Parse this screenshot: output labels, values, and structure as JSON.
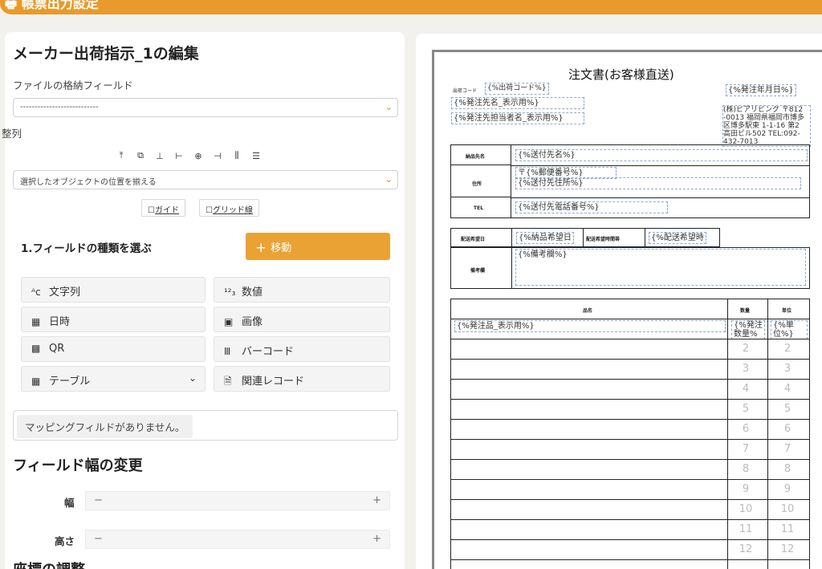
{
  "header": {
    "title": "帳票出力設定"
  },
  "left": {
    "edit_title": "メーカー出荷指示_1の編集",
    "storage_label": "ファイルの格納フィールド",
    "storage_value": "---------------------------",
    "align_label": "整列",
    "align_select": "選択したオブジェクトの位置を揃える",
    "guide": "ガイド",
    "grid": "グリッド線",
    "step1": "1.フィールドの種類を選ぶ",
    "move": "移動",
    "tiles": {
      "text": "文字列",
      "number": "数値",
      "datetime": "日時",
      "image": "画像",
      "qr": "QR",
      "barcode": "バーコード",
      "table": "テーブル",
      "related": "関連レコード"
    },
    "mapping_msg": "マッピングフィルドがありません。",
    "width_title": "フィールド幅の変更",
    "width": "幅",
    "height": "高さ",
    "coord_title": "座標の調整"
  },
  "doc": {
    "title": "注文書(お客様直送)",
    "ship_code_label": "出荷コード",
    "ship_code": "{%出荷コード%}",
    "order_date": "{%発注年月日%}",
    "order_name": "{%発注先名_表示用%}",
    "order_person": "{%発注先担当者名_表示用%}",
    "company_lines": [
      "(株)ピアリビング 〒812",
      "-0013 福岡県福岡市博多",
      "区博多駅東 1-1-16 第2",
      "高田ビル502 TEL:092-",
      "432-7013"
    ],
    "deliver_name_label": "納品先名",
    "deliver_name": "{%送付先名%}",
    "address_label": "住所",
    "postal": "〒{%郵便番号%}",
    "address": "{%送付先住所%}",
    "tel_label": "TEL",
    "tel": "{%送付先電話番号%}",
    "wish_date_label": "配送希望日",
    "wish_date": "{%納品希望日",
    "wish_time_label": "配送希望時間帯",
    "wish_time": "{%配送希望時",
    "remarks_label": "備考欄",
    "remarks": "{%備考欄%}",
    "col_item": "品名",
    "col_qty": "数量",
    "col_unit": "単位",
    "item": "{%発注品_表示用%}",
    "qty": "{%発注数量%",
    "unit": "{%単位%}",
    "row_numbers": [
      "2",
      "3",
      "4",
      "5",
      "6",
      "7",
      "8",
      "9",
      "10",
      "11",
      "12"
    ]
  },
  "colors": {
    "accent": "#e99a2c",
    "field_border": "#8ea8d8"
  }
}
